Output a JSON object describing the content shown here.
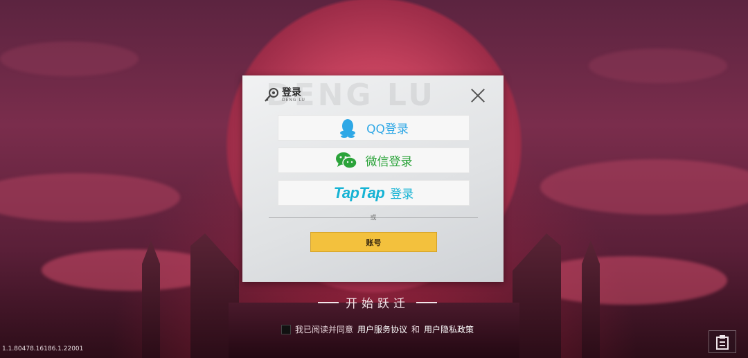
{
  "dialog": {
    "title": "登录",
    "title_sub": "DENG LU",
    "watermark": "DENG LU",
    "buttons": {
      "qq": "QQ登录",
      "wechat": "微信登录",
      "taptap_logo": "TapTap",
      "taptap_label": "登录"
    },
    "or_text": "或",
    "account_button": "账号"
  },
  "start_text": "开始跃迁",
  "agreement": {
    "prefix": "我已阅读并同意",
    "service_link": "用户服务协议",
    "and": "和",
    "privacy_link": "用户隐私政策"
  },
  "version": "1.1.80478.16186.1.22001",
  "colors": {
    "qq_blue": "#2fa8e6",
    "wechat_green": "#2ba33a",
    "taptap_cyan": "#16b3d4",
    "account_yellow": "#f3c13d"
  },
  "icons": [
    "key-icon",
    "close-icon",
    "qq-icon",
    "wechat-icon",
    "notice-icon"
  ]
}
